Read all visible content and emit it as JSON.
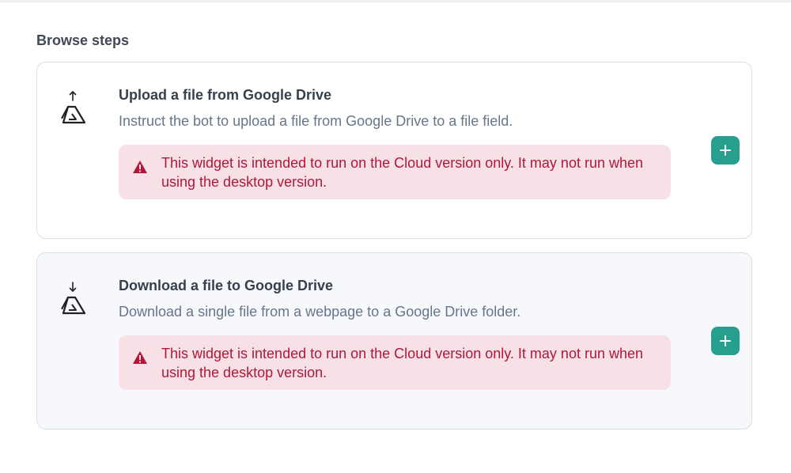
{
  "section": {
    "title": "Browse steps"
  },
  "steps": [
    {
      "title": "Upload a file from Google Drive",
      "description": "Instruct the bot to upload a file from Google Drive to a file field.",
      "icon": "google-drive-upload-icon",
      "warning": "This widget is intended to run on the Cloud version only. It may not run when using the desktop version."
    },
    {
      "title": "Download a file to Google Drive",
      "description": "Download a single file from a webpage to a Google Drive folder.",
      "icon": "google-drive-download-icon",
      "warning": "This widget is intended to run on the Cloud version only. It may not run when using the desktop version."
    }
  ],
  "colors": {
    "accent": "#279f8f",
    "warning_bg": "#f7e1e6",
    "warning_text": "#b01738"
  }
}
